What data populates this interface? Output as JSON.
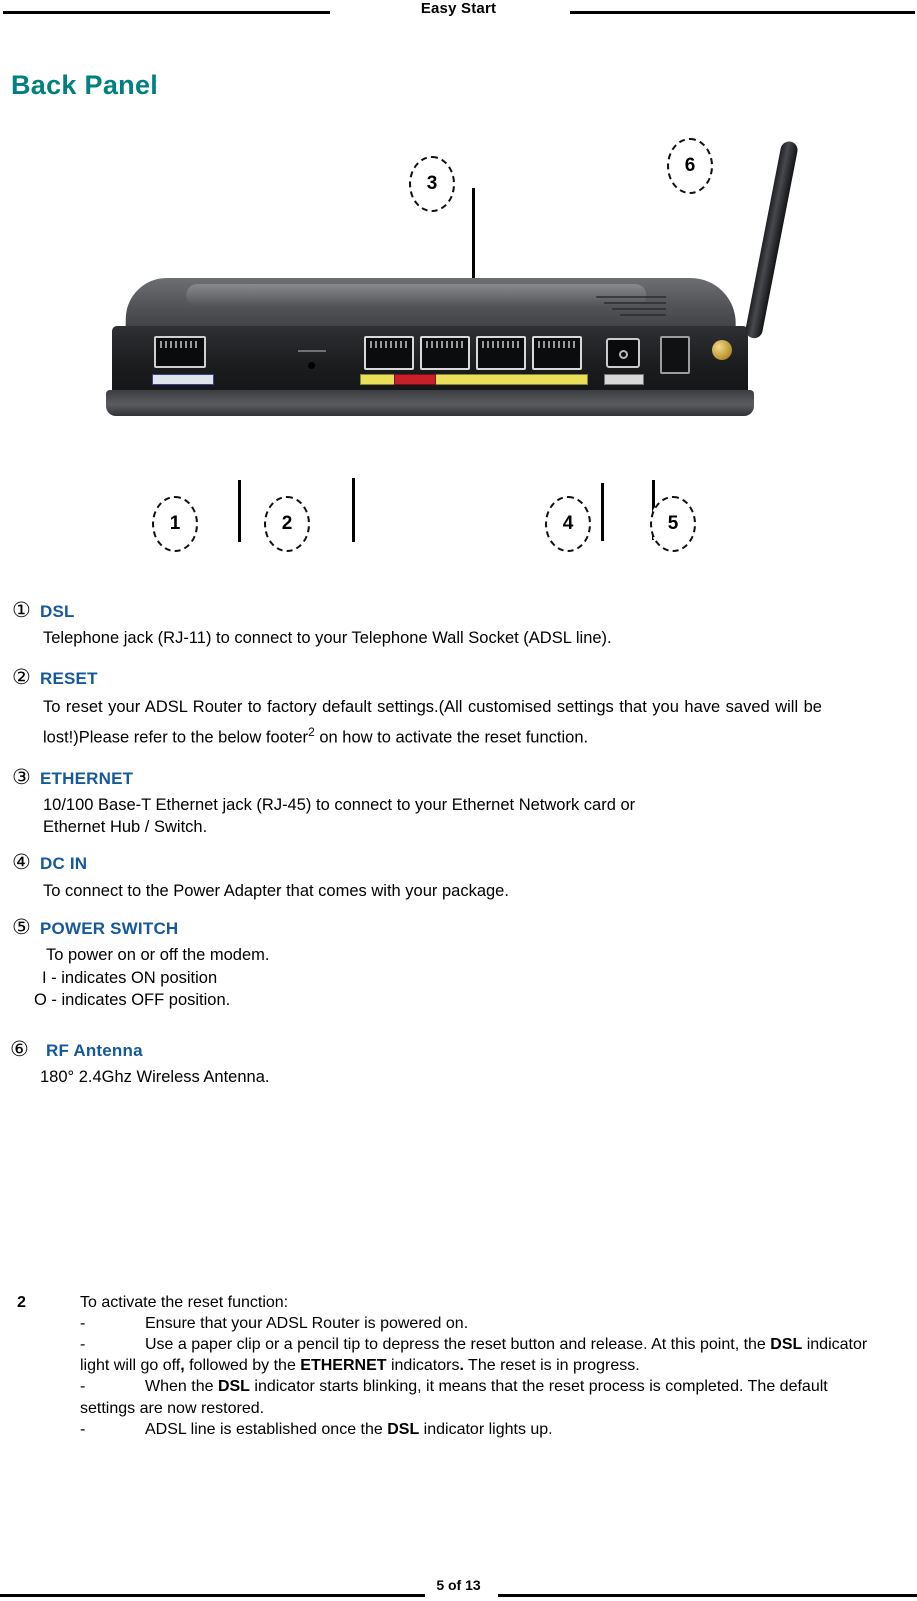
{
  "header": {
    "title": "Easy Start"
  },
  "section": {
    "title": "Back Panel",
    "title_color": "#008080"
  },
  "photo": {
    "alt_name": "adsl-router-back-panel-photo",
    "callouts": [
      {
        "number": "1"
      },
      {
        "number": "2"
      },
      {
        "number": "3"
      },
      {
        "number": "4"
      },
      {
        "number": "5"
      },
      {
        "number": "6"
      }
    ]
  },
  "items": [
    {
      "num": "①",
      "title": "DSL",
      "body": "Telephone jack (RJ-11) to connect to your Telephone Wall Socket (ADSL line)."
    },
    {
      "num": "②",
      "title": "RESET",
      "body_part1": "To reset your ADSL Router to factory default settings.(All customised settings that you have saved will be lost!)Please refer to the below footer",
      "body_sup": "2",
      "body_part2": " on how to activate the reset function."
    },
    {
      "num": "③",
      "title": "ETHERNET",
      "body_line1": "10/100 Base-T Ethernet jack (RJ-45) to connect to your Ethernet Network card or",
      "body_line2": "Ethernet Hub / Switch."
    },
    {
      "num": "④",
      "title": "DC IN",
      "body": "To connect to the Power Adapter that comes with your package."
    },
    {
      "num": "⑤",
      "title": "POWER SWITCH",
      "body_line1": "To power on or off the modem.",
      "body_line2": "I - indicates ON position",
      "body_line3": "O - indicates OFF position."
    },
    {
      "num": "⑥",
      "title": "RF Antenna",
      "body": "180°  2.4Ghz Wireless Antenna."
    }
  ],
  "footnote": {
    "marker": "2",
    "intro": "To activate the reset function:",
    "dash": "-",
    "b1": "Ensure that your ADSL Router is powered on.",
    "b2_a": "Use a paper clip or a pencil tip to depress the reset button and release.  At this point, the ",
    "b2_bold1": "DSL",
    "b2_b": " indicator light will go off",
    "b2_comma": ",",
    "b2_c": " followed by the ",
    "b2_bold2": "ETHERNET",
    "b2_d": " indicators",
    "b2_period": ".",
    "b2_e": " The reset is in progress.",
    "b3_a": "When the ",
    "b3_bold": "DSL",
    "b3_b": " indicator starts blinking, it means that the reset process is completed. The default settings are now restored.",
    "b4_a": "ADSL line is established once the ",
    "b4_bold": "DSL",
    "b4_b": " indicator lights up."
  },
  "footer": {
    "page": "5 of 13"
  }
}
